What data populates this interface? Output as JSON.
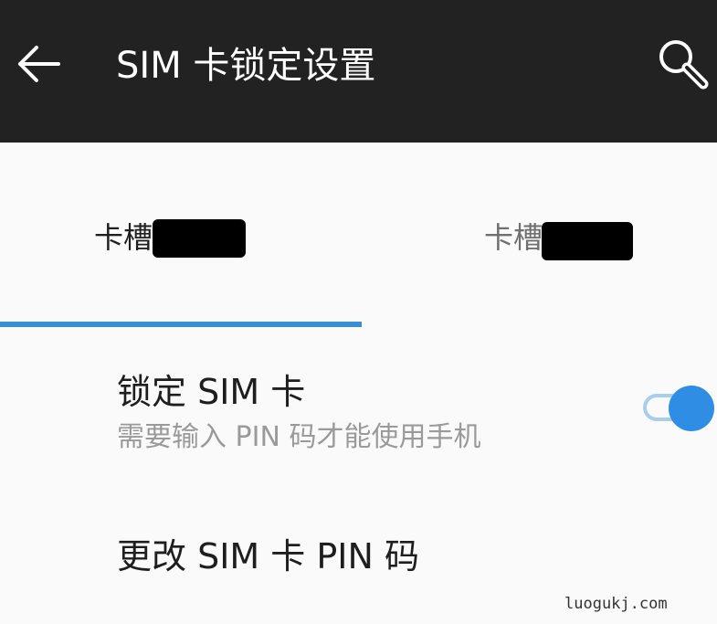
{
  "appbar": {
    "title": "SIM 卡锁定设置",
    "back_icon": "arrow-left-icon",
    "search_icon": "search-icon",
    "background": "#222222"
  },
  "tabs": [
    {
      "label": "卡槽",
      "selected": true
    },
    {
      "label": "卡槽",
      "selected": false
    }
  ],
  "accent": "#3a8fd4",
  "settings": {
    "lock_sim": {
      "title": "锁定 SIM 卡",
      "subtitle": "需要输入 PIN 码才能使用手机",
      "enabled": true
    },
    "change_pin": {
      "title": "更改 SIM 卡 PIN 码"
    }
  },
  "watermark": "luogukj.com"
}
